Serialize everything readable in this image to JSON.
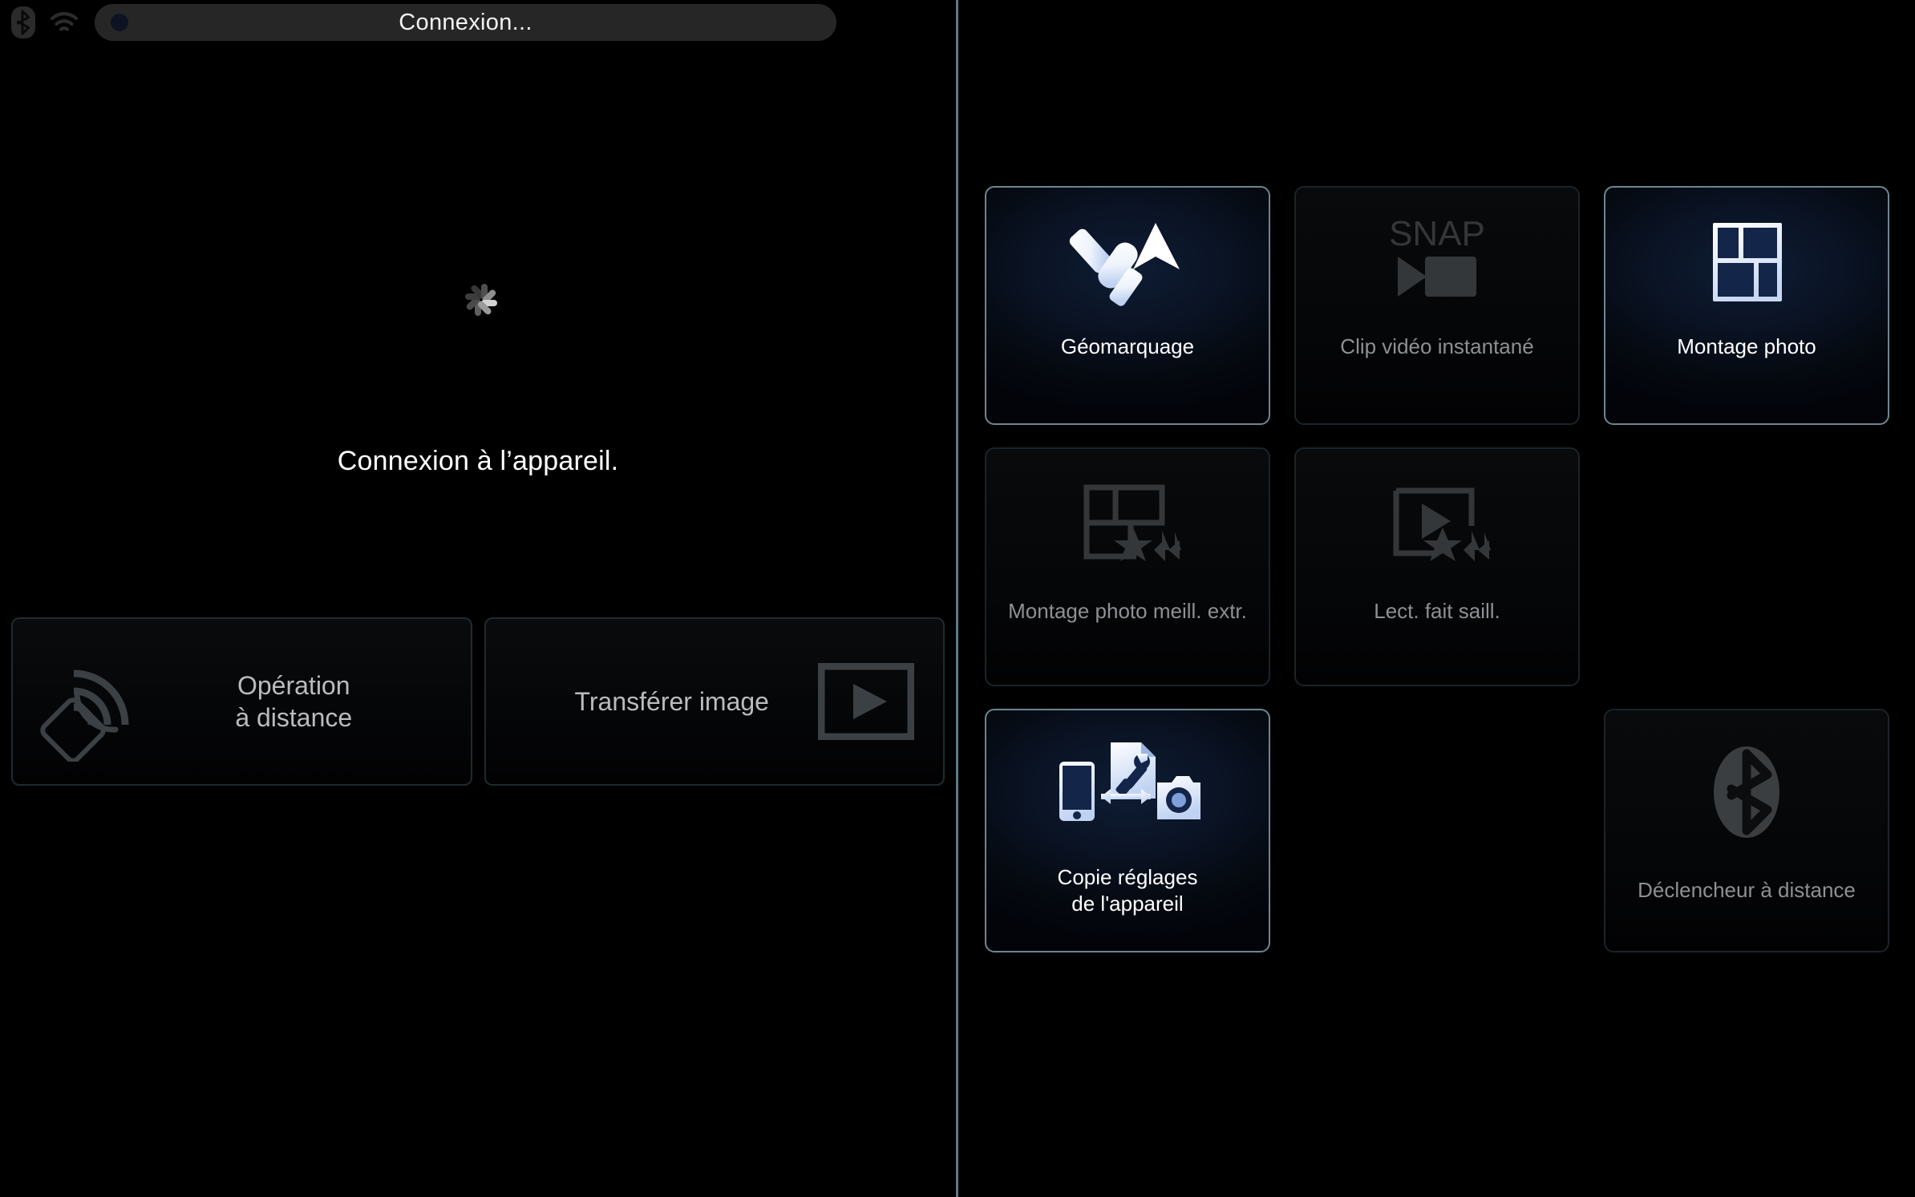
{
  "statusbar": {
    "bluetooth_icon": "bluetooth-icon",
    "wifi_icon": "wifi-icon",
    "title": "Connexion...",
    "indicator_dot": "recording-dot"
  },
  "left_panel": {
    "spinner_icon": "loading-spinner",
    "message": "Connexion à l’appareil.",
    "buttons": [
      {
        "id": "remote-operation",
        "label_line1": "Opération",
        "label_line2": "à distance",
        "icon": "remote-control-icon",
        "enabled": false
      },
      {
        "id": "transfer-image",
        "label": "Transférer image",
        "icon": "play-frame-icon",
        "enabled": false
      }
    ]
  },
  "right_panel": {
    "tiles": [
      {
        "id": "geotagging",
        "label": "Géomarquage",
        "icon": "satellite-navigation-icon",
        "state": "enabled"
      },
      {
        "id": "snap-movie",
        "label": "Clip vidéo instantané",
        "icon": "snap-video-camera-icon",
        "icon_text": "SNAP",
        "state": "disabled"
      },
      {
        "id": "photo-collage",
        "label": "Montage photo",
        "icon": "photo-collage-grid-icon",
        "state": "enabled"
      },
      {
        "id": "best-moment-collage",
        "label": "Montage photo meill. extr.",
        "icon": "collage-stars-icon",
        "state": "disabled"
      },
      {
        "id": "highlight-playback",
        "label": "Lect. fait saill.",
        "icon": "play-stars-icon",
        "state": "disabled"
      },
      {
        "id": "empty-slot-1",
        "label": "",
        "icon": "",
        "state": "blank"
      },
      {
        "id": "copy-camera-settings",
        "label_line1": "Copie réglages",
        "label_line2": "de l'appareil",
        "icon": "phone-camera-settings-icon",
        "state": "enabled"
      },
      {
        "id": "empty-slot-2",
        "label": "",
        "icon": "",
        "state": "blank"
      },
      {
        "id": "bluetooth-remote-release",
        "label": "Déclencheur à distance",
        "icon": "bluetooth-icon",
        "state": "disabled"
      }
    ]
  },
  "colors": {
    "background": "#000000",
    "divider": "#5b7d8c",
    "active_tile_border": "#6b8792",
    "disabled_tile_border": "#19242a",
    "active_tile_bg": "#0a1324",
    "active_label": "#ffffff",
    "disabled_label": "#8d9194",
    "title_pill_bg": "#262626",
    "icon_disabled": "#333639",
    "icon_active": "#ffffff",
    "collage_pane": "#14254a"
  }
}
